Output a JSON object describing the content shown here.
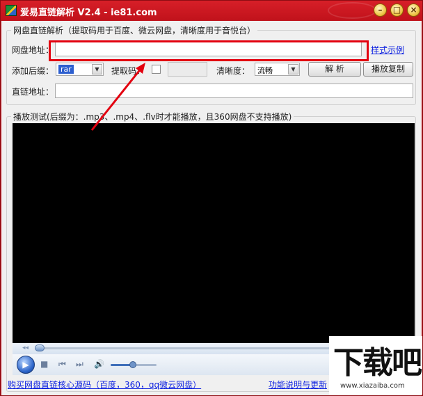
{
  "window": {
    "title": "爱易直链解析 V2.4 - ie81.com",
    "controls": {
      "minimize": "–",
      "restore": "□",
      "close": "×"
    }
  },
  "parse_group": {
    "legend": "网盘直链解析（提取码用于百度、微云网盘，清晰度用于音悦台）",
    "url_label": "网盘地址：",
    "url_value": "",
    "example_link": "样式示例",
    "suffix_label": "添加后缀：",
    "suffix_value": "rar",
    "code_label": "提取码：",
    "code_checked": false,
    "code_value": "",
    "quality_label": "清晰度：",
    "quality_value": "流畅",
    "parse_button": "解 析",
    "play_copy_button": "播放复制",
    "direct_label": "直链地址：",
    "direct_value": ""
  },
  "playback_group": {
    "legend": "播放测试(后缀为：.mp3、.mp4、.flv时才能播放，且360网盘不支持播放)"
  },
  "player": {
    "play_icon": "play-icon",
    "stop_icon": "stop-icon",
    "prev_icon": "skip-back-icon",
    "next_icon": "skip-forward-icon",
    "volume_icon": "speaker-icon",
    "seek_position": 0.0,
    "volume_level": 0.45
  },
  "footer": {
    "buy_link": "购买网盘直链核心源码（百度，360，qq微云网盘）",
    "help_link": "功能说明与更新"
  },
  "watermark": {
    "brand": "下载吧",
    "url": "www.xiazaiba.com"
  },
  "colors": {
    "titlebar": "#c9151e",
    "highlight": "#e3000f",
    "link": "#0b1fe0"
  }
}
